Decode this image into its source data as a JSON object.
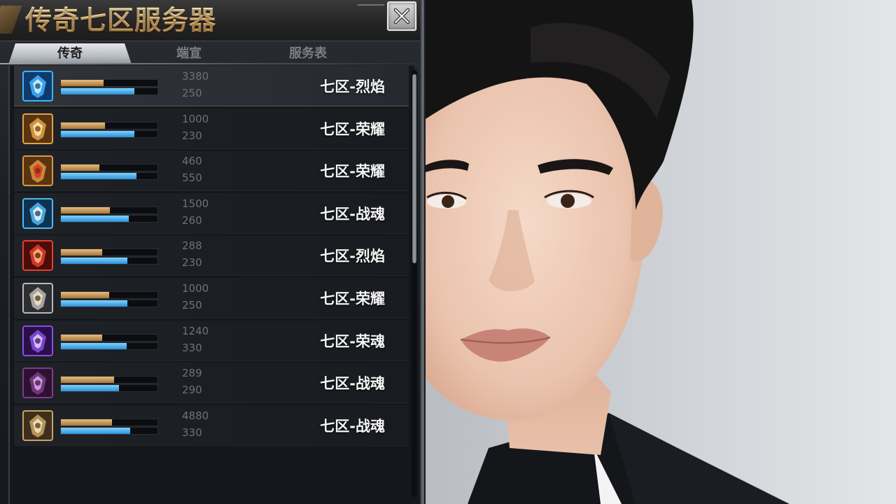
{
  "window": {
    "title": "传奇七区服务器",
    "close_icon": "close-icon"
  },
  "tabs": [
    {
      "label": "传奇",
      "active": true
    },
    {
      "label": "端宣",
      "active": false
    },
    {
      "label": "服务表",
      "active": false
    }
  ],
  "servers": [
    {
      "name": "七区-烈焰",
      "stat_top": "3380",
      "stat_bottom": "250",
      "icon": "blue-crystal-emblem-icon",
      "gold_fill": 0.44,
      "blue_fill": 0.76,
      "selected": true
    },
    {
      "name": "七区-荣耀",
      "stat_top": "1000",
      "stat_bottom": "230",
      "icon": "gold-dragon-emblem-icon",
      "gold_fill": 0.46,
      "blue_fill": 0.76,
      "selected": false
    },
    {
      "name": "七区-荣耀",
      "stat_top": "460",
      "stat_bottom": "550",
      "icon": "gold-red-gem-emblem-icon",
      "gold_fill": 0.4,
      "blue_fill": 0.78,
      "selected": false
    },
    {
      "name": "七区-战魂",
      "stat_top": "1500",
      "stat_bottom": "260",
      "icon": "blue-frost-emblem-icon",
      "gold_fill": 0.51,
      "blue_fill": 0.7,
      "selected": false
    },
    {
      "name": "七区-烈焰",
      "stat_top": "288",
      "stat_bottom": "230",
      "icon": "red-flame-emblem-icon",
      "gold_fill": 0.43,
      "blue_fill": 0.69,
      "selected": false
    },
    {
      "name": "七区-荣耀",
      "stat_top": "1000",
      "stat_bottom": "250",
      "icon": "silver-crossed-swords-emblem-icon",
      "gold_fill": 0.5,
      "blue_fill": 0.69,
      "selected": false
    },
    {
      "name": "七区-荣魂",
      "stat_top": "1240",
      "stat_bottom": "330",
      "icon": "purple-arcane-emblem-icon",
      "gold_fill": 0.43,
      "blue_fill": 0.68,
      "selected": false
    },
    {
      "name": "七区-战魂",
      "stat_top": "289",
      "stat_bottom": "290",
      "icon": "purple-demon-emblem-icon",
      "gold_fill": 0.55,
      "blue_fill": 0.6,
      "selected": false
    },
    {
      "name": "七区-战魂",
      "stat_top": "4880",
      "stat_bottom": "330",
      "icon": "gold-shield-emblem-icon",
      "gold_fill": 0.53,
      "blue_fill": 0.72,
      "selected": false
    }
  ],
  "colors": {
    "title_gold": "#e7b66e",
    "gold_bar": "#c8965a",
    "blue_bar": "#4fb6f0",
    "panel_bg": "#1c1f24"
  },
  "photo": {
    "subject": "portrait-photo"
  }
}
